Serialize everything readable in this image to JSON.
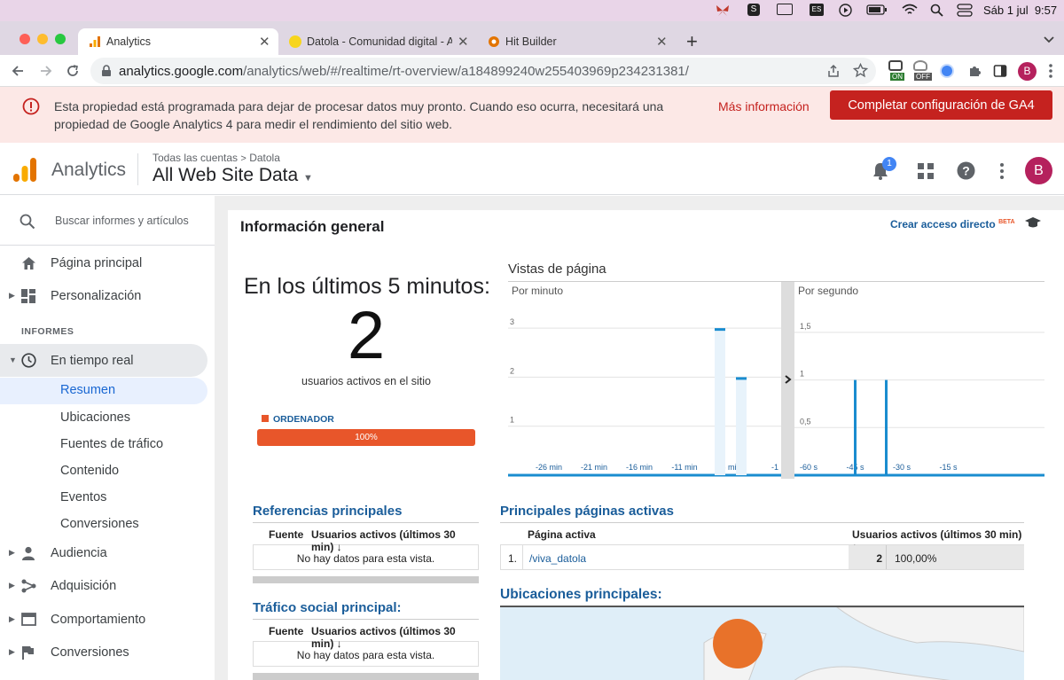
{
  "menubar": {
    "date": "Sáb 1 jul",
    "time": "9:57",
    "lang": "ES"
  },
  "tabs": [
    {
      "label": "Analytics",
      "active": true
    },
    {
      "label": "Datola - Comunidad digital - A",
      "active": false
    },
    {
      "label": "Hit Builder",
      "active": false
    }
  ],
  "toolbar": {
    "url_host": "analytics.google.com",
    "url_path": "/analytics/web/#/realtime/rt-overview/a184899240w255403969p234231381/",
    "profile_initial": "B",
    "ext_on": "ON",
    "ext_off": "OFF"
  },
  "banner": {
    "text": "Esta propiedad está programada para dejar de procesar datos muy pronto. Cuando eso ocurra, necesitará una propiedad de Google Analytics 4 para medir el rendimiento del sitio web.",
    "link": "Más información",
    "button": "Completar configuración de GA4"
  },
  "header": {
    "app_name": "Analytics",
    "breadcrumb_root": "Todas las cuentas",
    "breadcrumb_account": "Datola",
    "property": "All Web Site Data",
    "notification_count": "1",
    "avatar_initial": "B"
  },
  "sidebar": {
    "search_placeholder": "Buscar informes y artículos",
    "home": "Página principal",
    "custom": "Personalización",
    "section_reports": "INFORMES",
    "realtime": "En tiempo real",
    "realtime_items": [
      "Resumen",
      "Ubicaciones",
      "Fuentes de tráfico",
      "Contenido",
      "Eventos",
      "Conversiones"
    ],
    "audience": "Audiencia",
    "acquisition": "Adquisición",
    "behavior": "Comportamiento",
    "conversions": "Conversiones"
  },
  "overview": {
    "title": "Información general",
    "shortcut": "Crear acceso directo",
    "beta": "BETA",
    "last5_label": "En los últimos 5 minutos:",
    "active_users": "2",
    "active_users_label": "usuarios activos en el sitio",
    "device_label": "ORDENADOR",
    "device_pct": "100%",
    "device_share": 1.0,
    "colors": {
      "device": "#e8562a",
      "chart": "#1a8ccf",
      "title": "#1a5d9a"
    }
  },
  "pageviews": {
    "title": "Vistas de página",
    "per_minute_label": "Por minuto",
    "per_second_label": "Por segundo"
  },
  "chart_data": [
    {
      "type": "bar",
      "title": "Por minuto",
      "x_ticks": [
        "-26 min",
        "-21 min",
        "-16 min",
        "-11 min",
        "-6 min",
        "-1"
      ],
      "y_ticks": [
        "1",
        "2",
        "3"
      ],
      "ylim": [
        0,
        3.4
      ],
      "values": [
        {
          "x": -2,
          "y": 3
        },
        {
          "x": -1,
          "y": 2
        }
      ]
    },
    {
      "type": "bar",
      "title": "Por segundo",
      "x_ticks": [
        "-60 s",
        "-45 s",
        "-30 s",
        "-15 s"
      ],
      "y_ticks": [
        "0,5",
        "1",
        "1,5"
      ],
      "ylim": [
        0,
        1.75
      ],
      "values": [
        {
          "x": -45,
          "y": 1
        },
        {
          "x": -35,
          "y": 1
        }
      ]
    }
  ],
  "referrals": {
    "title": "Referencias principales",
    "col_source": "Fuente",
    "col_users": "Usuarios activos (últimos 30 min)",
    "empty": "No hay datos para esta vista."
  },
  "social": {
    "title": "Tráfico social principal:",
    "col_source": "Fuente",
    "col_users": "Usuarios activos (últimos 30 min)",
    "empty": "No hay datos para esta vista."
  },
  "active_pages": {
    "title": "Principales páginas activas",
    "col_page": "Página activa",
    "col_users": "Usuarios activos (últimos 30 min)",
    "rows": [
      {
        "rank": "1.",
        "page": "/viva_datola",
        "users": "2",
        "pct": "100,00%"
      }
    ]
  },
  "locations": {
    "title": "Ubicaciones principales:"
  }
}
